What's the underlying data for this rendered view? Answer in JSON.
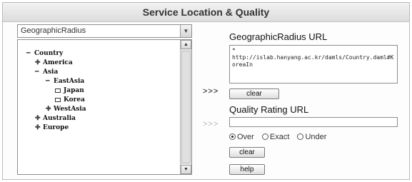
{
  "window": {
    "title": "Service Location & Quality"
  },
  "selector": {
    "value": "GeographicRadius",
    "arrow_icon": "chevron-down-icon"
  },
  "tree": {
    "nodes": [
      {
        "label": "Country",
        "icon": "minus"
      },
      {
        "label": "America",
        "icon": "plus"
      },
      {
        "label": "Asia",
        "icon": "minus"
      },
      {
        "label": "EastAsia",
        "icon": "minus"
      },
      {
        "label": "Japan",
        "icon": "folder"
      },
      {
        "label": "Korea",
        "icon": "folder"
      },
      {
        "label": "WestAsia",
        "icon": "plus"
      },
      {
        "label": "Australia",
        "icon": "plus"
      },
      {
        "label": "Europe",
        "icon": "plus"
      }
    ]
  },
  "transfer": {
    "url_arrow": ">>>",
    "rating_arrow": ">>>"
  },
  "url_section": {
    "heading": "GeographicRadius URL",
    "marker": "*",
    "value": "http://islab.hanyang.ac.kr/damls/Country.daml#KoreaIn",
    "clear_label": "clear"
  },
  "rating_section": {
    "heading": "Quality Rating URL",
    "value": "",
    "options": [
      "Over",
      "Exact",
      "Under"
    ],
    "selected": "Over",
    "clear_label": "clear",
    "help_label": "help"
  }
}
